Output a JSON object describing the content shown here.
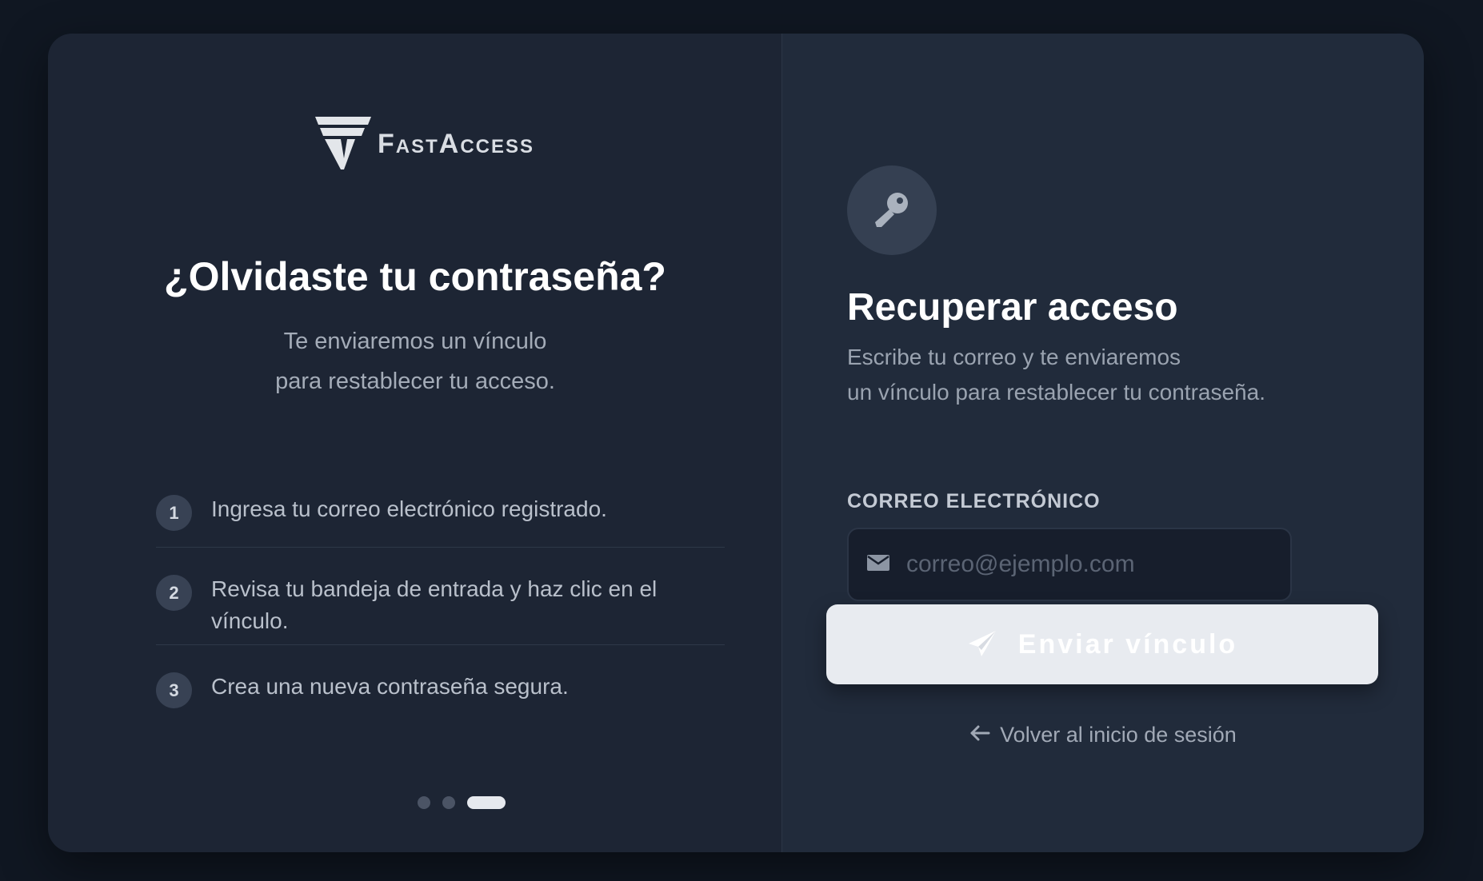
{
  "brand": {
    "name": "FastAccess",
    "logo_icon": "fastaccess-logo-icon"
  },
  "left": {
    "title": "¿Olvidaste tu contraseña?",
    "subtitle": "Te enviaremos un vínculo para restablecer tu acceso.",
    "steps": [
      {
        "number": "1",
        "text": "Ingresa tu correo electrónico registrado."
      },
      {
        "number": "2",
        "text": "Revisa tu bandeja de entrada y haz clic en el vínculo."
      },
      {
        "number": "3",
        "text": "Crea una nueva contraseña segura."
      }
    ],
    "carousel": {
      "total": 3,
      "active_index": 2
    }
  },
  "right": {
    "icon": "key-icon",
    "title": "Recuperar acceso",
    "description_line1": "Escribe tu correo y te enviaremos",
    "description_line2": "un vínculo para restablecer tu contraseña.",
    "email_label": "CORREO ELECTRÓNICO",
    "email_placeholder": "correo@ejemplo.com",
    "email_value": "",
    "email_icon": "envelope-icon",
    "submit_label": "Enviar vínculo",
    "submit_icon": "paper-plane-icon",
    "back_label": "Volver al inicio de sesión",
    "back_icon": "arrow-left-icon"
  },
  "colors": {
    "background": "#101722",
    "left_panel": "#1d2534",
    "right_panel": "#212b3b",
    "button": "#e8ebf0"
  }
}
